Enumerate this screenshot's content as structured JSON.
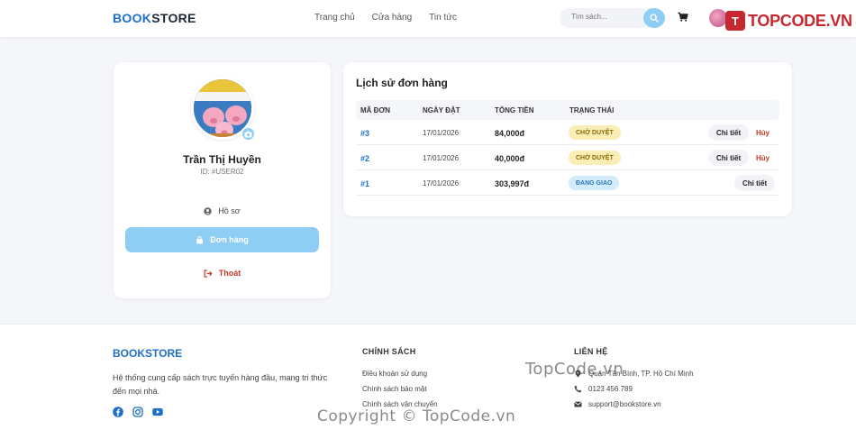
{
  "header": {
    "logo_accent": "BOOK",
    "logo_rest": "STORE",
    "nav": [
      "Trang chủ",
      "Cửa hàng",
      "Tin tức"
    ],
    "search_placeholder": "Tìm sách...",
    "brand_watermark": "TOPCODE.VN"
  },
  "profile": {
    "name": "Trần Thị Huyền",
    "user_id": "ID: #USER02",
    "menu": {
      "profile": "Hồ sơ",
      "orders": "Đơn hàng",
      "logout": "Thoát"
    }
  },
  "orders": {
    "title": "Lịch sử đơn hàng",
    "columns": [
      "MÃ ĐƠN",
      "NGÀY ĐẶT",
      "TỔNG TIỀN",
      "TRẠNG THÁI"
    ],
    "rows": [
      {
        "id": "#3",
        "date": "17/01/2026",
        "total": "84,000đ",
        "status": "CHỜ DUYỆT",
        "detail": "Chi tiết",
        "cancel": "Hủy"
      },
      {
        "id": "#2",
        "date": "17/01/2026",
        "total": "40,000đ",
        "status": "CHỜ DUYỆT",
        "detail": "Chi tiết",
        "cancel": "Hủy"
      },
      {
        "id": "#1",
        "date": "17/01/2026",
        "total": "303,997đ",
        "status": "ĐANG GIAO",
        "detail": "Chi tiết",
        "cancel": ""
      }
    ]
  },
  "footer": {
    "logo": "BOOKSTORE",
    "description": "Hệ thống cung cấp sách trực tuyến hàng đầu, mang tri thức đến mọi nhà.",
    "policy_heading": "CHÍNH SÁCH",
    "policy_links": [
      "Điều khoản sử dụng",
      "Chính sách bảo mật",
      "Chính sách vận chuyển"
    ],
    "contact_heading": "LIÊN HỆ",
    "address": "Quận Tân Bình, TP. Hồ Chí Minh",
    "phone": "0123 456 789",
    "email": "support@bookstore.vn"
  },
  "watermarks": {
    "line1": "TopCode.vn",
    "line2": "Copyright © TopCode.vn"
  },
  "colors": {
    "brand_blue": "#1f6fc9",
    "button_light_blue": "#8ecdf4",
    "cancel_red": "#c0392b",
    "pending_badge": "#fbedb6",
    "shipping_badge": "#d2ecfb"
  },
  "icons": [
    "search-icon",
    "cart-icon",
    "camera-icon",
    "user-circle-icon",
    "shopping-bag-icon",
    "logout-icon",
    "facebook-icon",
    "instagram-icon",
    "youtube-icon",
    "map-marker-icon",
    "phone-icon",
    "envelope-icon"
  ]
}
